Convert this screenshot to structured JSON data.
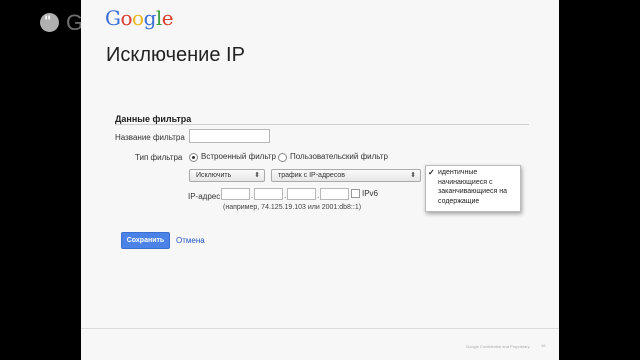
{
  "slide": {
    "logo": [
      "G",
      "o",
      "o",
      "g",
      "l",
      "e"
    ],
    "hangouts_logo": "Google",
    "title": "Исключение IP",
    "footer": "Google Confidential and Proprietary",
    "page_number": "16"
  },
  "form": {
    "section_title": "Данные фильтра",
    "name_label": "Название фильтра",
    "name_value": "",
    "type_label": "Тип фильтра",
    "type_options": [
      "Встроенный фильтр",
      "Пользовательский фильтр"
    ],
    "type_selected": "Встроенный фильтр",
    "action_select": "Исключить",
    "field_select": "трафик с IP-адресов",
    "condition_options": [
      "идентичные",
      "начинающиеся с",
      "заканчивающиеся на",
      "содержащие"
    ],
    "condition_selected": "идентичные",
    "ip_label": "IP-адрес",
    "ip_values": [
      "",
      "",
      "",
      ""
    ],
    "ipv6_label": "IPv6",
    "ipv6_checked": false,
    "ip_example": "(например, 74.125.19.103 или 2001:db8::1)",
    "save_label": "Сохранить",
    "cancel_label": "Отмена"
  },
  "colors": {
    "save_button": "#4a82e8",
    "link": "#2255c4",
    "slide_background": "#f7f7f7"
  },
  "icons": {
    "dropdown_arrow": "updown-arrow-icon",
    "selected_check": "check-icon",
    "hangouts": "hangouts-icon"
  }
}
